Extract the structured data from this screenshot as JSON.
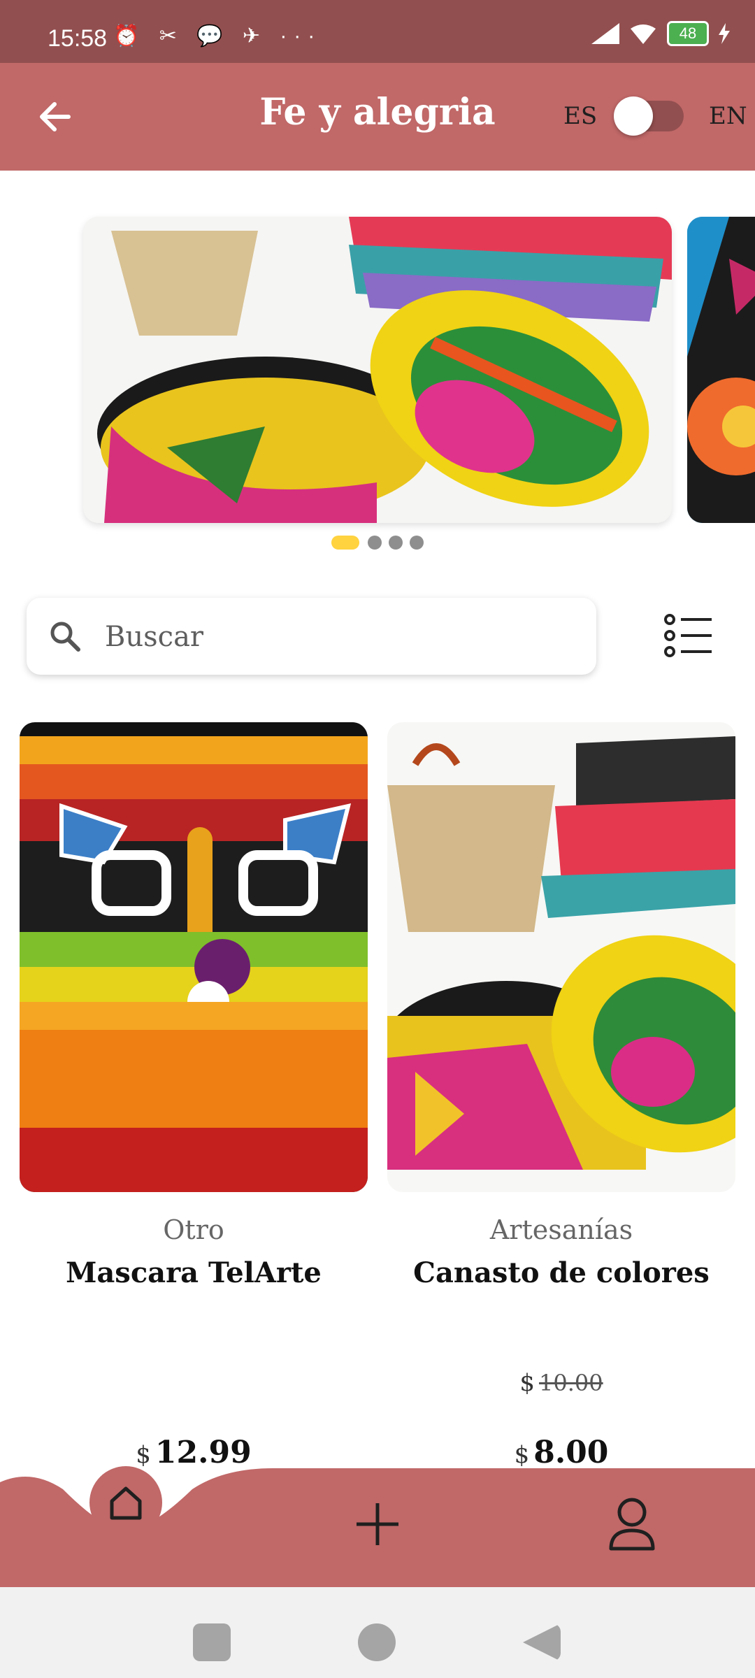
{
  "status_bar": {
    "time": "15:58",
    "notification_icons": "⏰ ✂ 💬 ✈ ···",
    "battery": "48"
  },
  "app_bar": {
    "title": "Fe y alegria",
    "lang_left": "ES",
    "lang_right": "EN",
    "toggle_on": false
  },
  "carousel": {
    "slides": 4,
    "active_index": 0
  },
  "search": {
    "placeholder": "Buscar",
    "value": ""
  },
  "products": [
    {
      "category": "Otro",
      "name": "Mascara TelArte",
      "price_currency": "$",
      "price": "12.99",
      "old_price": ""
    },
    {
      "category": "Artesanías",
      "name": "Canasto de colores",
      "price_currency": "$",
      "price": "8.00",
      "old_price_currency": "$",
      "old_price": "10.00"
    }
  ],
  "bottom_nav": {
    "items": [
      "home-icon",
      "plus-icon",
      "user-icon"
    ],
    "active": "home-icon"
  },
  "colors": {
    "primary": "#c16868",
    "status_bar": "#924f4f",
    "dot_active": "#ffd23f"
  }
}
